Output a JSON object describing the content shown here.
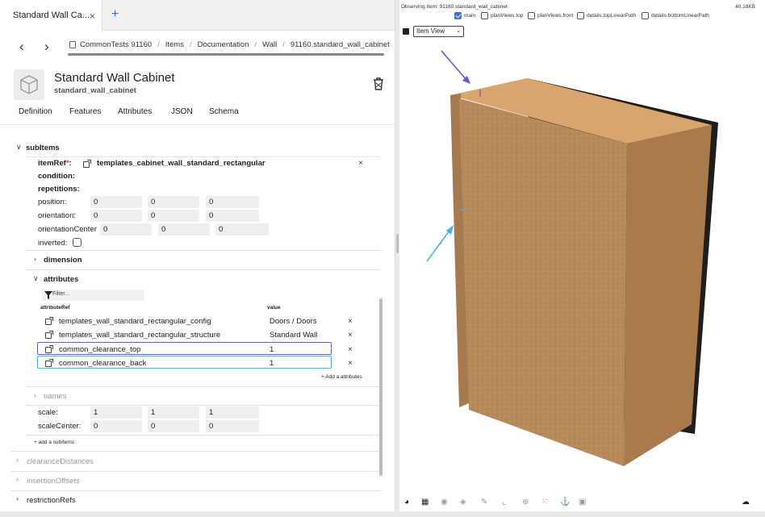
{
  "tab": {
    "title": "Standard Wall Ca...",
    "close": "×",
    "new": "+"
  },
  "nav": {
    "back": "‹",
    "forward": "›"
  },
  "breadcrumb": [
    "CommonTests 91160",
    "Items",
    "Documentation",
    "Wall",
    "91160.standard_wall_cabinet"
  ],
  "header": {
    "title": "Standard Wall Cabinet",
    "subtitle": "standard_wall_cabinet",
    "thumb_icon": "cube-icon",
    "delete_icon": "trash-icon"
  },
  "subtabs": [
    "Definition",
    "Features",
    "Attributes",
    "JSON",
    "Schema"
  ],
  "subitems": {
    "heading": "subItems",
    "itemref_label": "itemRef",
    "itemref_required": "*",
    "itemref_colon": ":",
    "itemref_value": "templates_cabinet_wall_standard_rectangular",
    "remove": "×",
    "condition": "condition:",
    "repetitions": "repetitions:",
    "position_label": "position:",
    "position": [
      "0",
      "0",
      "0"
    ],
    "orientation_label": "orientation:",
    "orientation": [
      "0",
      "0",
      "0"
    ],
    "orientation_center_label": "orientationCenter",
    "orientation_center": [
      "0",
      "0",
      "0"
    ],
    "inverted_label": "inverted:",
    "dimension": "dimension",
    "attributes": "attributes",
    "filter_placeholder": "Filter...",
    "col_attributeRef": "attributeRef",
    "col_value": "value",
    "attribute_rows": [
      {
        "ref": "templates_wall_standard_rectangular_config",
        "value": "Doors / Doors"
      },
      {
        "ref": "templates_wall_standard_rectangular_structure",
        "value": "Standard Wall"
      },
      {
        "ref": "common_clearance_top",
        "value": "1"
      },
      {
        "ref": "common_clearance_back",
        "value": "1"
      }
    ],
    "add_attribute": "+ Add a attributes",
    "names": "names",
    "scale_label": "scale:",
    "scale": [
      "1",
      "1",
      "1"
    ],
    "scale_center_label": "scaleCenter:",
    "scale_center": [
      "0",
      "0",
      "0"
    ],
    "add_subitem": "+ add a subItems"
  },
  "sections": [
    "clearanceDistances",
    "insertionOffsets",
    "restrictionRefs"
  ],
  "viewer": {
    "observing": "Observing Item: 91160.standard_wall_cabinet",
    "size": "40.18KB",
    "checkboxes": [
      {
        "label": "main",
        "checked": true
      },
      {
        "label": "planViews.top",
        "checked": false
      },
      {
        "label": "planViews.front",
        "checked": false
      },
      {
        "label": "details.topLinearPath",
        "checked": false
      },
      {
        "label": "details.bottomLinearPath",
        "checked": false
      }
    ],
    "view_select": "Item View",
    "view_select_arrow": "⌄",
    "colors": {
      "wood": "#b88a5a",
      "wood_top": "#d9a56e",
      "back_panel": "#1e1e1e",
      "arrow_top": "#6a4fd8",
      "arrow_side": "#3fb6e6"
    }
  },
  "toolbar_icons": [
    "palette-icon",
    "grid-icon",
    "compass-icon",
    "cube-icon",
    "brush-icon",
    "measure-icon",
    "target-icon",
    "dots-icon",
    "anchor-icon",
    "image-icon",
    "cloud-download-icon"
  ]
}
